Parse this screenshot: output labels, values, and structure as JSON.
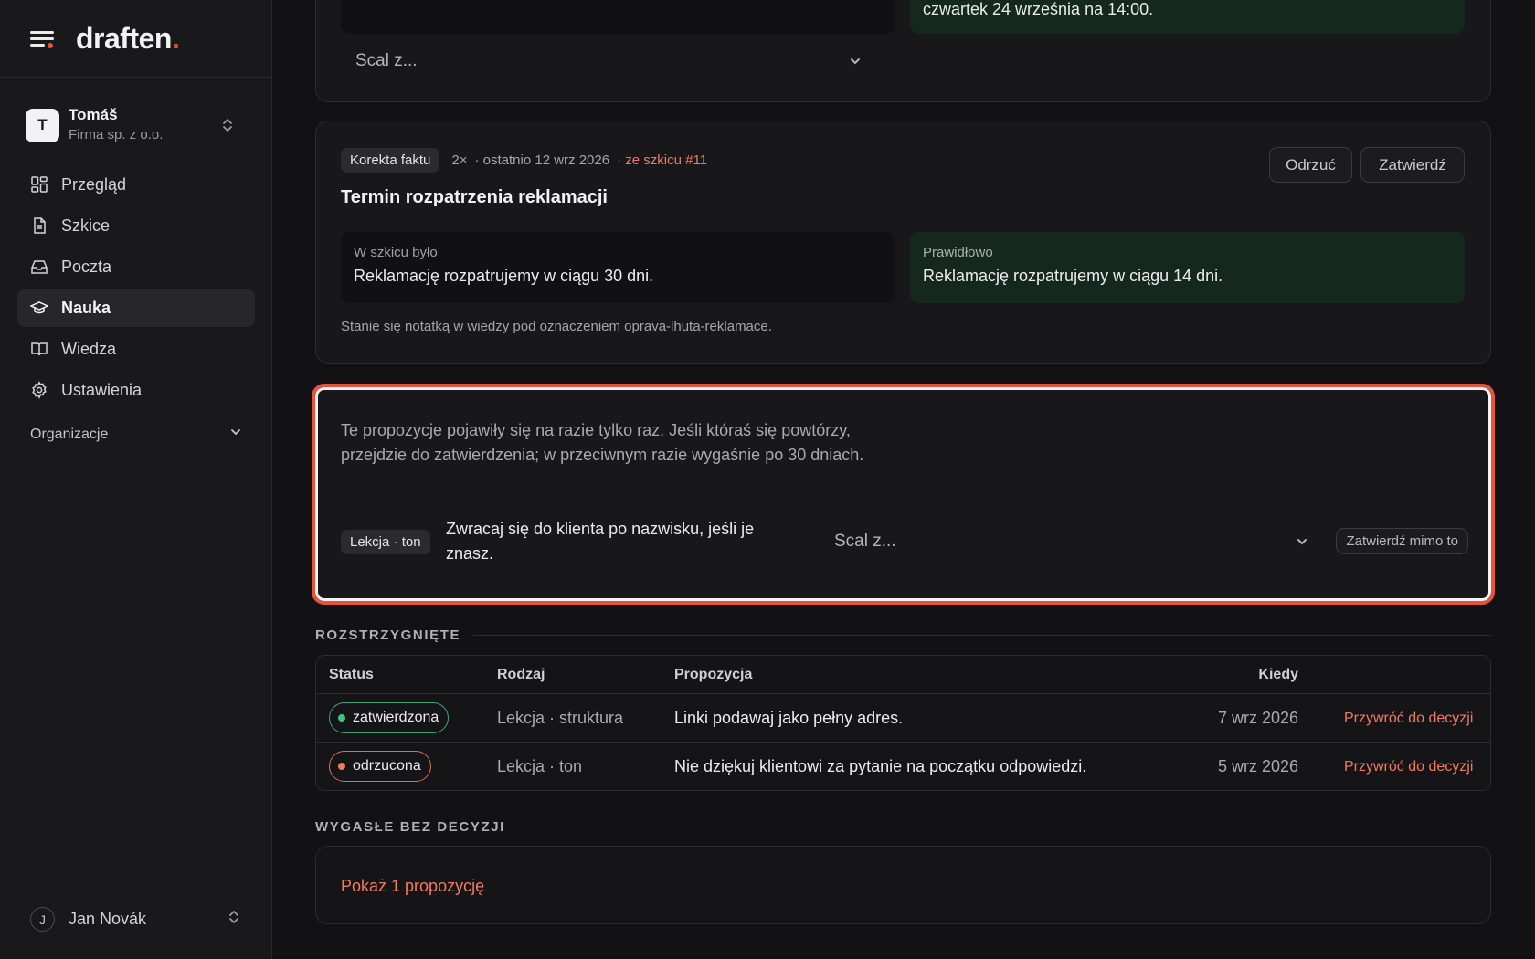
{
  "brand": {
    "name": "draften",
    "dot": "."
  },
  "workspace": {
    "initial": "T",
    "name": "Tomáš",
    "company": "Firma sp. z o.o."
  },
  "nav": [
    {
      "label": "Przegląd",
      "icon": "grid-icon"
    },
    {
      "label": "Szkice",
      "icon": "file-icon"
    },
    {
      "label": "Poczta",
      "icon": "inbox-icon"
    },
    {
      "label": "Nauka",
      "icon": "graduation-cap-icon",
      "active": true
    },
    {
      "label": "Wiedza",
      "icon": "book-icon"
    },
    {
      "label": "Ustawienia",
      "icon": "gear-icon"
    }
  ],
  "org_section": "Organizacje",
  "user": {
    "initial": "J",
    "name": "Jan Novák"
  },
  "top_card": {
    "green_text": "czwartek 24 września na 14:00.",
    "merge_placeholder": "Scal z..."
  },
  "fix_card": {
    "tag": "Korekta faktu",
    "count": "2×",
    "last": "· ostatnio 12 wrz 2026",
    "source": "· ze szkicu #11",
    "reject": "Odrzuć",
    "approve": "Zatwierdź",
    "title": "Termin rozpatrzenia reklamacji",
    "was_label": "W szkicu było",
    "was_text": "Reklamację rozpatrujemy w ciągu 30 dni.",
    "correct_label": "Prawidłowo",
    "correct_text": "Reklamację rozpatrujemy w ciągu 14 dni.",
    "note": "Stanie się notatką w wiedzy pod oznaczeniem oprava-lhuta-reklamace."
  },
  "pending_card": {
    "info": "Te propozycje pojawiły się na razie tylko raz. Jeśli któraś się powtórzy, przejdzie do zatwierdzenia; w przeciwnym razie wygaśnie po 30 dniach.",
    "tag": "Lekcja · ton",
    "lesson": "Zwracaj się do klienta po nazwisku, jeśli je znasz.",
    "merge_placeholder": "Scal z...",
    "approve_anyway": "Zatwierdź mimo to"
  },
  "resolved": {
    "label": "ROZSTRZYGNIĘTE",
    "headers": {
      "status": "Status",
      "kind": "Rodzaj",
      "proposal": "Propozycja",
      "when": "Kiedy"
    },
    "rows": [
      {
        "status": "zatwierdzona",
        "kind": "Lekcja · struktura",
        "proposal": "Linki podawaj jako pełny adres.",
        "when": "7 wrz 2026",
        "action": "Przywróć do decyzji"
      },
      {
        "status": "odrzucona",
        "kind": "Lekcja · ton",
        "proposal": "Nie dziękuj klientowi za pytanie na początku odpowiedzi.",
        "when": "5 wrz 2026",
        "action": "Przywróć do decyzji"
      }
    ]
  },
  "expired": {
    "label": "WYGASŁE BEZ DECYZJI",
    "show": "Pokaż 1 propozycję"
  },
  "colors": {
    "accent": "#e5533d",
    "link": "#f07a5f",
    "approved": "#3fc480",
    "rejected": "#f07a5f",
    "background": "#121214",
    "sidebar": "#19191c"
  }
}
